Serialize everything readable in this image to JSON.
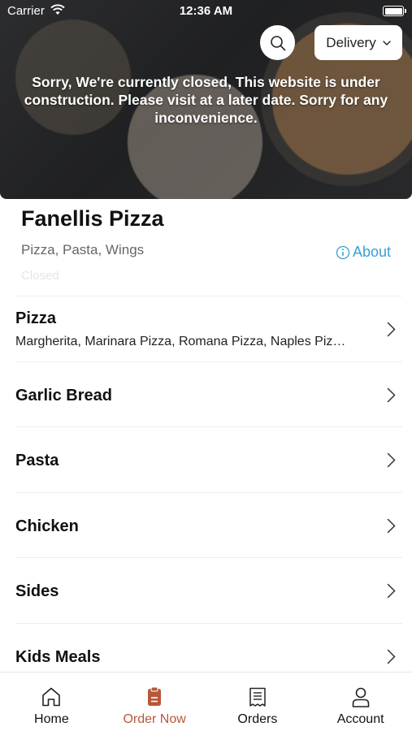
{
  "status_bar": {
    "carrier": "Carrier",
    "time": "12:36 AM"
  },
  "header": {
    "delivery_label": "Delivery",
    "closed_notice": "Sorry, We're currently closed, This website is under construction. Please visit at a later date. Sorry for any inconvenience."
  },
  "restaurant": {
    "name": "Fanellis Pizza",
    "cuisines": "Pizza, Pasta, Wings",
    "about_label": "About",
    "status": "Closed"
  },
  "categories": [
    {
      "title": "Pizza",
      "subtitle": "Margherita, Marinara Pizza, Romana Pizza, Naples Piz…"
    },
    {
      "title": "Garlic Bread"
    },
    {
      "title": "Pasta"
    },
    {
      "title": "Chicken"
    },
    {
      "title": "Sides"
    },
    {
      "title": "Kids Meals"
    }
  ],
  "bottom_nav": [
    {
      "label": "Home",
      "icon": "home-icon"
    },
    {
      "label": "Order Now",
      "icon": "order-icon",
      "active": true
    },
    {
      "label": "Orders",
      "icon": "receipt-icon"
    },
    {
      "label": "Account",
      "icon": "person-icon"
    }
  ],
  "colors": {
    "accent": "#b8583a",
    "link": "#3a9fd0"
  }
}
